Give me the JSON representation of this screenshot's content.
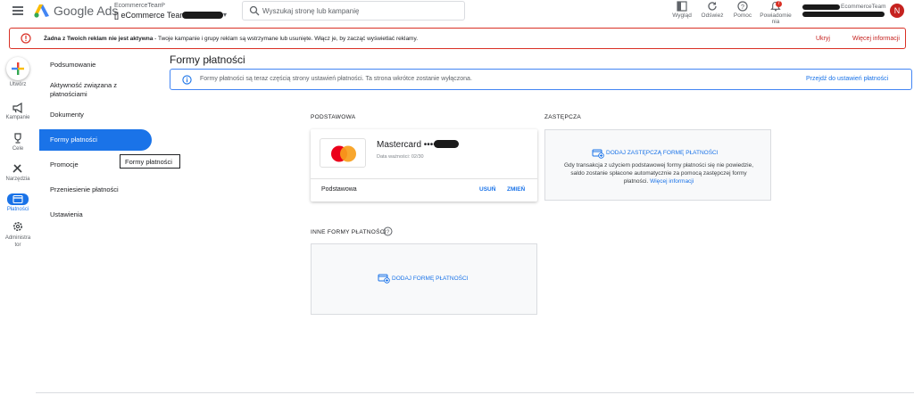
{
  "header": {
    "product_name": "Google Ads",
    "account_parent": "EcommerceTeam",
    "account_parent_chevron": ">",
    "account_name": "[] eCommerce Team",
    "search_placeholder": "Wyszukaj stronę lub kampanię",
    "buttons": [
      {
        "label": "Wygląd",
        "icon": "appearance-icon"
      },
      {
        "label": "Odśwież",
        "icon": "refresh-icon"
      },
      {
        "label": "Pomoc",
        "icon": "help-icon"
      },
      {
        "label": "Powiadomie nia",
        "icon": "bell-icon",
        "badge": "7"
      }
    ],
    "user_account": "EcommerceTeam",
    "avatar_letter": "N"
  },
  "alert": {
    "bold_text": "Żadna z Twoich reklam nie jest aktywna",
    "text": " - Twoje kampanie i grupy reklam są wstrzymane lub usunięte. Włącz je, by zacząć wyświetlać reklamy.",
    "hide_label": "Ukryj",
    "more_label": "Więcej informacji",
    "color": "#d93025"
  },
  "rail": {
    "items": [
      {
        "label": "Utwórz",
        "icon": "plus-icon"
      },
      {
        "label": "Kampanie",
        "icon": "megaphone-icon"
      },
      {
        "label": "Cele",
        "icon": "trophy-icon"
      },
      {
        "label": "Narzędzia",
        "icon": "tools-icon"
      },
      {
        "label": "Płatności",
        "icon": "credit-card-icon",
        "active": true
      },
      {
        "label": "Administra tor",
        "icon": "admin-gear-icon"
      }
    ]
  },
  "nav": {
    "items": [
      {
        "label": "Podsumowanie"
      },
      {
        "label": "Aktywność związana z płatnościami"
      },
      {
        "label": "Dokumenty"
      },
      {
        "label": "Formy płatności",
        "active": true
      },
      {
        "label": "Promocje"
      },
      {
        "label": "Przeniesienie płatności"
      },
      {
        "label": "Ustawienia"
      }
    ],
    "tooltip": "Formy płatności"
  },
  "main": {
    "title": "Formy płatności",
    "info_text": "Formy płatności są teraz częścią strony ustawień płatności. Ta strona wkrótce zostanie wyłączona.",
    "info_link": "Przejdź do ustawień płatności",
    "primary_header": "Podstawowa",
    "backup_header": "Zastępcza",
    "card": {
      "title": "Mastercard ••••",
      "expiry": "Data ważności: 02/30",
      "type_label": "Podstawowa",
      "remove_label": "USUŃ",
      "change_label": "ZMIEŃ"
    },
    "backup": {
      "add_label": "DODAJ ZASTĘPCZĄ FORMĘ PŁATNOŚCI",
      "description": "Gdy transakcja z użyciem podstawowej formy płatności się nie powiedzie, saldo zostanie spłacone automatycznie za pomocą zastępczej formy płatności. ",
      "more_link": "Więcej informacji"
    },
    "other_header": "Inne formy płatności",
    "other_add_label": "DODAJ FORMĘ PŁATNOŚCI"
  },
  "colors": {
    "accent": "#1a73e8",
    "mastercard_red": "#eb001b",
    "mastercard_orange": "#f79e1b"
  }
}
